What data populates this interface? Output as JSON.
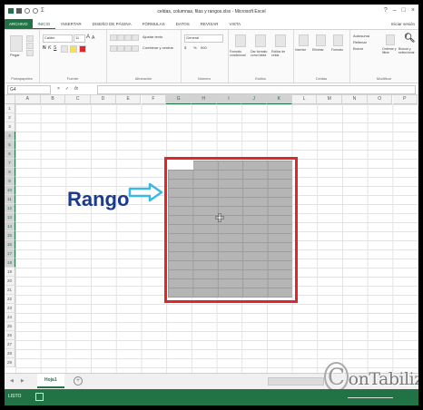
{
  "window": {
    "title": "celdas, columnas, filas y rangos.xlsx - Microsoft Excel",
    "help": "?",
    "minimize": "–",
    "maximize": "□",
    "close": "×"
  },
  "ribbon_tabs": {
    "file": "ARCHIVO",
    "items": [
      "INICIO",
      "INSERTAR",
      "DISEÑO DE PÁGINA",
      "FÓRMULAS",
      "DATOS",
      "REVISAR",
      "VISTA"
    ],
    "active": "INICIO",
    "signin": "Iniciar sesión"
  },
  "ribbon": {
    "clipboard": {
      "label": "Portapapeles",
      "paste": "Pegar"
    },
    "font": {
      "label": "Fuente",
      "name": "Calibri",
      "size": "11",
      "bold": "N",
      "italic": "K",
      "underline": "S"
    },
    "alignment": {
      "label": "Alineación",
      "wrap": "Ajustar texto",
      "merge": "Combinar y centrar"
    },
    "number": {
      "label": "Número",
      "format": "General",
      "currency": "$",
      "percent": "%",
      "thousands": "000"
    },
    "styles": {
      "label": "Estilos",
      "conditional": "Formato condicional",
      "table": "Dar formato como tabla",
      "cell": "Estilos de celda"
    },
    "cells": {
      "label": "Celdas",
      "insert": "Insertar",
      "delete": "Eliminar",
      "format": "Formato"
    },
    "editing": {
      "label": "Modificar",
      "autosum": "Autosuma",
      "fill": "Rellenar",
      "clear": "Borrar",
      "sort": "Ordenar y filtrar",
      "find": "Buscar y seleccionar"
    }
  },
  "formula_bar": {
    "name_box": "G4",
    "cancel": "×",
    "enter": "✓",
    "fx": "fx",
    "value": ""
  },
  "columns": [
    "A",
    "B",
    "C",
    "D",
    "E",
    "F",
    "G",
    "H",
    "I",
    "J",
    "K",
    "L",
    "M",
    "N",
    "O",
    "P"
  ],
  "selected_columns": [
    "G",
    "H",
    "I",
    "J",
    "K"
  ],
  "rows": [
    "1",
    "2",
    "3",
    "4",
    "5",
    "6",
    "7",
    "8",
    "9",
    "10",
    "11",
    "12",
    "13",
    "14",
    "15",
    "16",
    "17",
    "18",
    "19",
    "20",
    "21",
    "22",
    "23",
    "24",
    "25",
    "26",
    "27",
    "28",
    "29"
  ],
  "selected_rows": [
    "4",
    "5",
    "6",
    "7",
    "8",
    "9",
    "10",
    "11",
    "12",
    "13",
    "14",
    "15",
    "16",
    "17",
    "18"
  ],
  "annotation": {
    "text": "Rango",
    "color": "#1b3a8f",
    "arrow_color": "#3ab8e8",
    "outline_color": "#e0262a"
  },
  "sheet_bar": {
    "prev": "◀",
    "next": "▶",
    "tab": "Hoja1",
    "add": "+"
  },
  "watermark": {
    "initial": "C",
    "text": "onTabilizal"
  },
  "status": {
    "mode": "LISTO"
  },
  "colors": {
    "excel_green": "#217346"
  }
}
